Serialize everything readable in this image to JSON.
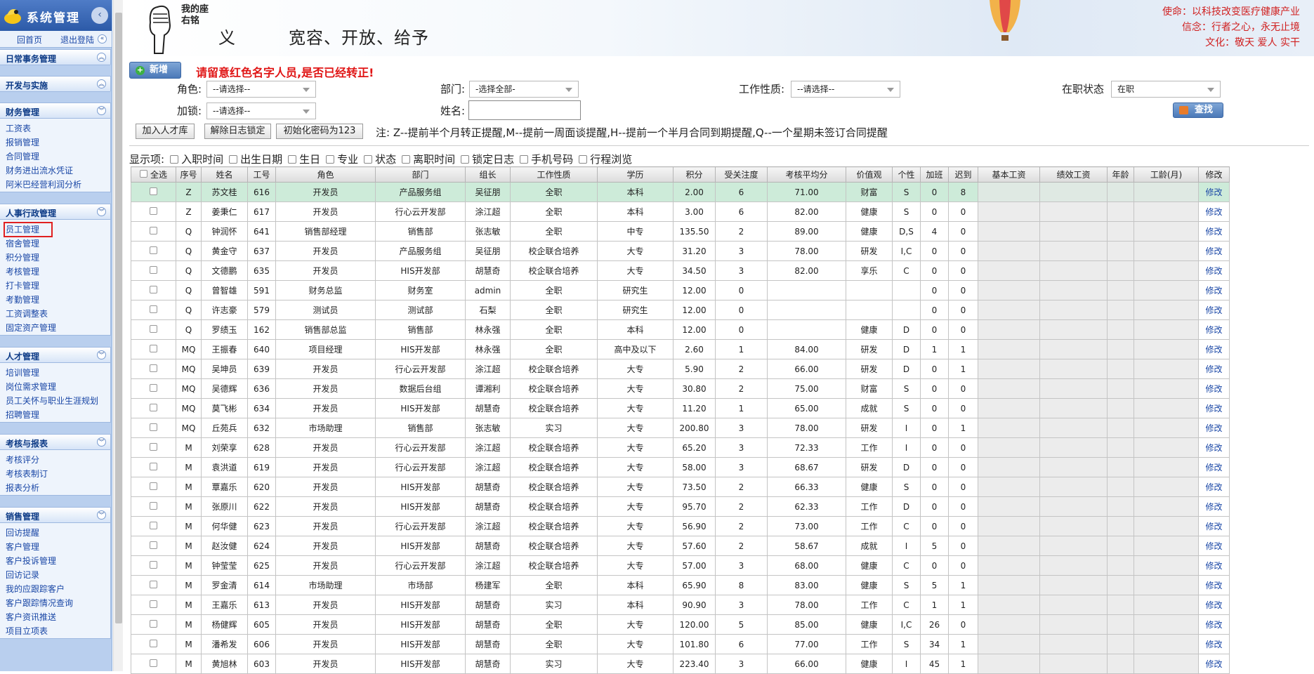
{
  "sidebar": {
    "title": "系统管理",
    "collapse_icon": "chevron-left-icon",
    "home": "回首页",
    "logout": "退出登陆",
    "groups": [
      {
        "title": "日常事务管理",
        "items": []
      },
      {
        "title": "开发与实施",
        "items": []
      },
      {
        "title": "财务管理",
        "items": [
          "工资表",
          "报销管理",
          "合同管理",
          "财务进出流水凭证",
          "阿米巴经营利润分析"
        ]
      },
      {
        "title": "人事行政管理",
        "items": [
          "员工管理",
          "宿舍管理",
          "积分管理",
          "考核管理",
          "打卡管理",
          "考勤管理",
          "工资调整表",
          "固定资产管理"
        ]
      },
      {
        "title": "人才管理",
        "items": [
          "培训管理",
          "岗位需求管理",
          "员工关怀与职业生涯规划",
          "招聘管理"
        ]
      },
      {
        "title": "考核与报表",
        "items": [
          "考核评分",
          "考核表制订",
          "报表分析"
        ]
      },
      {
        "title": "销售管理",
        "items": [
          "回访提醒",
          "客户管理",
          "客户投诉管理",
          "回访记录",
          "我的应跟踪客户",
          "客户跟踪情况查询",
          "客户资讯推送",
          "项目立项表"
        ]
      }
    ]
  },
  "banner": {
    "motto_vertical": "我的座右铭",
    "motto_char": "义",
    "motto_text": "宽容、开放、给予",
    "mission": "使命：以科技改变医疗健康产业",
    "belief": "信念：行者之心，永无止境",
    "culture": "文化：敬天 爱人 实干"
  },
  "toolbar": {
    "new_label": "新增",
    "warning": "请留意红色名字人员,是否已经转正!",
    "role_label": "角色:",
    "role_value": "--请选择--",
    "dept_label": "部门:",
    "dept_value": "-选择全部-",
    "jobtype_label": "工作性质:",
    "jobtype_value": "--请选择--",
    "status_label": "在职状态",
    "status_value": "在职",
    "lock_label": "加锁:",
    "lock_value": "--请选择--",
    "name_label": "姓名:",
    "name_value": "",
    "search_label": "查找",
    "btn_talent": "加入人才库",
    "btn_unlock": "解除日志锁定",
    "btn_resetpw": "初始化密码为123",
    "note": "注: Z--提前半个月转正提醒,M--提前一周面谈提醒,H--提前一个半月合同到期提醒,Q--一个星期未签订合同提醒"
  },
  "display": {
    "label": "显示项:",
    "options": [
      "入职时间",
      "出生日期",
      "生日",
      "专业",
      "状态",
      "离职时间",
      "锁定日志",
      "手机号码",
      "行程浏览"
    ]
  },
  "table": {
    "headers": [
      "全选",
      "序号",
      "姓名",
      "工号",
      "角色",
      "部门",
      "组长",
      "工作性质",
      "学历",
      "积分",
      "受关注度",
      "考核平均分",
      "价值观",
      "个性",
      "加班",
      "迟到",
      "基本工资",
      "绩效工资",
      "年龄",
      "工龄(月)",
      "修改"
    ],
    "rows": [
      [
        "",
        "Z",
        "苏文桂",
        "616",
        "开发员",
        "产品服务组",
        "吴征朋",
        "全职",
        "本科",
        "2.00",
        "6",
        "71.00",
        "财富",
        "S",
        "0",
        "8",
        "",
        "",
        "",
        "",
        "修改"
      ],
      [
        "",
        "Z",
        "姜秉仁",
        "617",
        "开发员",
        "行心云开发部",
        "涂江超",
        "全职",
        "本科",
        "3.00",
        "6",
        "82.00",
        "健康",
        "S",
        "0",
        "0",
        "",
        "",
        "",
        "",
        "修改"
      ],
      [
        "",
        "Q",
        "钟润怀",
        "641",
        "销售部经理",
        "销售部",
        "张志敏",
        "全职",
        "中专",
        "135.50",
        "2",
        "89.00",
        "健康",
        "D,S",
        "4",
        "0",
        "",
        "",
        "",
        "",
        "修改"
      ],
      [
        "",
        "Q",
        "黄金守",
        "637",
        "开发员",
        "产品服务组",
        "吴征朋",
        "校企联合培养",
        "大专",
        "31.20",
        "3",
        "78.00",
        "研发",
        "I,C",
        "0",
        "0",
        "",
        "",
        "",
        "",
        "修改"
      ],
      [
        "",
        "Q",
        "文德鹏",
        "635",
        "开发员",
        "HIS开发部",
        "胡慧奇",
        "校企联合培养",
        "大专",
        "34.50",
        "3",
        "82.00",
        "享乐",
        "C",
        "0",
        "0",
        "",
        "",
        "",
        "",
        "修改"
      ],
      [
        "",
        "Q",
        "曾智雄",
        "591",
        "财务总监",
        "财务室",
        "admin",
        "全职",
        "研究生",
        "12.00",
        "0",
        "",
        "",
        "",
        "0",
        "0",
        "",
        "",
        "",
        "",
        "修改"
      ],
      [
        "",
        "Q",
        "许志豪",
        "579",
        "测试员",
        "测试部",
        "石梨",
        "全职",
        "研究生",
        "12.00",
        "0",
        "",
        "",
        "",
        "0",
        "0",
        "",
        "",
        "",
        "",
        "修改"
      ],
      [
        "",
        "Q",
        "罗绩玉",
        "162",
        "销售部总监",
        "销售部",
        "林永强",
        "全职",
        "本科",
        "12.00",
        "0",
        "",
        "健康",
        "D",
        "0",
        "0",
        "",
        "",
        "",
        "",
        "修改"
      ],
      [
        "",
        "MQ",
        "王振春",
        "640",
        "项目经理",
        "HIS开发部",
        "林永强",
        "全职",
        "高中及以下",
        "2.60",
        "1",
        "84.00",
        "研发",
        "D",
        "1",
        "1",
        "",
        "",
        "",
        "",
        "修改"
      ],
      [
        "",
        "MQ",
        "吴坤员",
        "639",
        "开发员",
        "行心云开发部",
        "涂江超",
        "校企联合培养",
        "大专",
        "5.90",
        "2",
        "66.00",
        "研发",
        "D",
        "0",
        "1",
        "",
        "",
        "",
        "",
        "修改"
      ],
      [
        "",
        "MQ",
        "吴德辉",
        "636",
        "开发员",
        "数据后台组",
        "谭湘利",
        "校企联合培养",
        "大专",
        "30.80",
        "2",
        "75.00",
        "财富",
        "S",
        "0",
        "0",
        "",
        "",
        "",
        "",
        "修改"
      ],
      [
        "",
        "MQ",
        "莫飞彬",
        "634",
        "开发员",
        "HIS开发部",
        "胡慧奇",
        "校企联合培养",
        "大专",
        "11.20",
        "1",
        "65.00",
        "成就",
        "S",
        "0",
        "0",
        "",
        "",
        "",
        "",
        "修改"
      ],
      [
        "",
        "MQ",
        "丘苑兵",
        "632",
        "市场助理",
        "销售部",
        "张志敏",
        "实习",
        "大专",
        "200.80",
        "3",
        "78.00",
        "研发",
        "I",
        "0",
        "1",
        "",
        "",
        "",
        "",
        "修改"
      ],
      [
        "",
        "M",
        "刘荣享",
        "628",
        "开发员",
        "行心云开发部",
        "涂江超",
        "校企联合培养",
        "大专",
        "65.20",
        "3",
        "72.33",
        "工作",
        "I",
        "0",
        "0",
        "",
        "",
        "",
        "",
        "修改"
      ],
      [
        "",
        "M",
        "袁洪道",
        "619",
        "开发员",
        "行心云开发部",
        "涂江超",
        "校企联合培养",
        "大专",
        "58.00",
        "3",
        "68.67",
        "研发",
        "D",
        "0",
        "0",
        "",
        "",
        "",
        "",
        "修改"
      ],
      [
        "",
        "M",
        "覃嘉乐",
        "620",
        "开发员",
        "HIS开发部",
        "胡慧奇",
        "校企联合培养",
        "大专",
        "73.50",
        "2",
        "66.33",
        "健康",
        "S",
        "0",
        "0",
        "",
        "",
        "",
        "",
        "修改"
      ],
      [
        "",
        "M",
        "张原川",
        "622",
        "开发员",
        "HIS开发部",
        "胡慧奇",
        "校企联合培养",
        "大专",
        "95.70",
        "2",
        "62.33",
        "工作",
        "D",
        "0",
        "0",
        "",
        "",
        "",
        "",
        "修改"
      ],
      [
        "",
        "M",
        "何华健",
        "623",
        "开发员",
        "行心云开发部",
        "涂江超",
        "校企联合培养",
        "大专",
        "56.90",
        "2",
        "73.00",
        "工作",
        "C",
        "0",
        "0",
        "",
        "",
        "",
        "",
        "修改"
      ],
      [
        "",
        "M",
        "赵汝健",
        "624",
        "开发员",
        "HIS开发部",
        "胡慧奇",
        "校企联合培养",
        "大专",
        "57.60",
        "2",
        "58.67",
        "成就",
        "I",
        "5",
        "0",
        "",
        "",
        "",
        "",
        "修改"
      ],
      [
        "",
        "M",
        "钟莹莹",
        "625",
        "开发员",
        "行心云开发部",
        "涂江超",
        "校企联合培养",
        "大专",
        "57.00",
        "3",
        "68.00",
        "健康",
        "C",
        "0",
        "0",
        "",
        "",
        "",
        "",
        "修改"
      ],
      [
        "",
        "M",
        "罗金清",
        "614",
        "市场助理",
        "市场部",
        "杨建军",
        "全职",
        "本科",
        "65.90",
        "8",
        "83.00",
        "健康",
        "S",
        "5",
        "1",
        "",
        "",
        "",
        "",
        "修改"
      ],
      [
        "",
        "M",
        "王嘉乐",
        "613",
        "开发员",
        "HIS开发部",
        "胡慧奇",
        "实习",
        "本科",
        "90.90",
        "3",
        "78.00",
        "工作",
        "C",
        "1",
        "1",
        "",
        "",
        "",
        "",
        "修改"
      ],
      [
        "",
        "M",
        "杨健辉",
        "605",
        "开发员",
        "HIS开发部",
        "胡慧奇",
        "全职",
        "大专",
        "120.00",
        "5",
        "85.00",
        "健康",
        "I,C",
        "26",
        "0",
        "",
        "",
        "",
        "",
        "修改"
      ],
      [
        "",
        "M",
        "潘希发",
        "606",
        "开发员",
        "HIS开发部",
        "胡慧奇",
        "全职",
        "大专",
        "101.80",
        "6",
        "77.00",
        "工作",
        "S",
        "34",
        "1",
        "",
        "",
        "",
        "",
        "修改"
      ],
      [
        "",
        "M",
        "黄旭林",
        "603",
        "开发员",
        "HIS开发部",
        "胡慧奇",
        "实习",
        "大专",
        "223.40",
        "3",
        "66.00",
        "健康",
        "I",
        "45",
        "1",
        "",
        "",
        "",
        "",
        "修改"
      ]
    ]
  },
  "colors": {
    "highlight_row": "#cdebd9",
    "warning": "#e01515",
    "link": "#1a47a6"
  }
}
